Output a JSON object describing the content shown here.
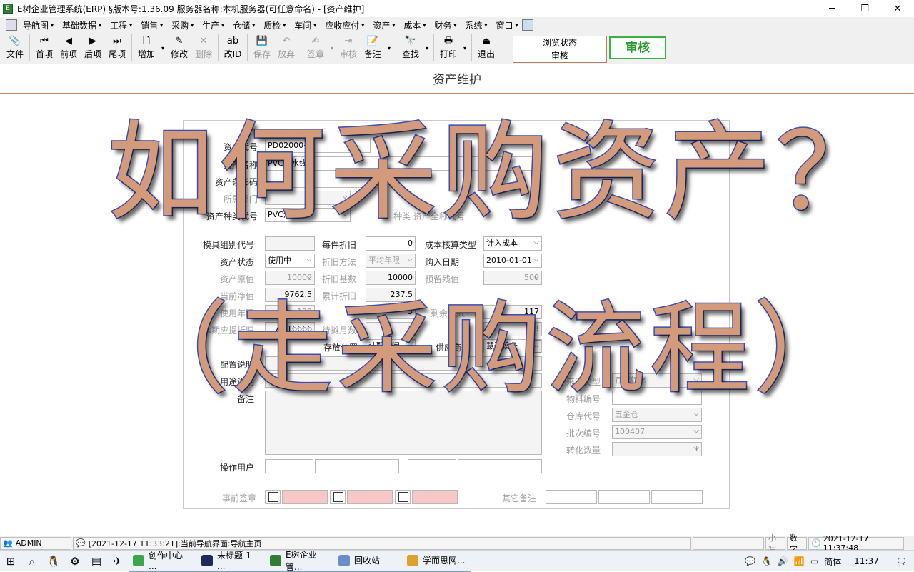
{
  "window": {
    "title": "E树企业管理系统(ERP) §版本号:1.36.09  服务器名称:本机服务器(可任意命名) - [资产维护]",
    "app_icon": "E",
    "minimize": "─",
    "restore": "❐",
    "close": "✕"
  },
  "menu": {
    "items": [
      "导航图",
      "基础数据",
      "工程",
      "销售",
      "采购",
      "生产",
      "仓储",
      "质检",
      "车间",
      "应收应付",
      "资产",
      "成本",
      "财务",
      "系统",
      "窗口"
    ]
  },
  "toolbar": {
    "buttons": [
      {
        "label": "文件",
        "icon": "📎"
      },
      {
        "label": "首项",
        "icon": "⏮"
      },
      {
        "label": "前项",
        "icon": "◀"
      },
      {
        "label": "后项",
        "icon": "▶"
      },
      {
        "label": "尾项",
        "icon": "⏭"
      },
      {
        "label": "增加",
        "icon": "🗋"
      },
      {
        "label": "修改",
        "icon": "✎"
      },
      {
        "label": "删除",
        "icon": "✕"
      },
      {
        "label": "改ID",
        "icon": "ab"
      },
      {
        "label": "保存",
        "icon": "💾"
      },
      {
        "label": "放弃",
        "icon": "↶"
      },
      {
        "label": "签章",
        "icon": "✍"
      },
      {
        "label": "审核",
        "icon": "⇥"
      },
      {
        "label": "备注",
        "icon": "📝"
      },
      {
        "label": "查找",
        "icon": "🔭"
      },
      {
        "label": "打印",
        "icon": "🖶"
      },
      {
        "label": "退出",
        "icon": "⏏"
      }
    ],
    "status_top": "浏览状态",
    "status_bottom": "审核",
    "audit_button": "审核"
  },
  "page_title": "资产维护",
  "overlay": {
    "line1": "如何采购资产？",
    "line2": "（走采购流程）"
  },
  "form": {
    "asset_code_label": "资产代号",
    "asset_code": "PD020004",
    "asset_name_label": "资产名称",
    "asset_name": "PVC流水线",
    "barcode_label": "资产条形码",
    "department_label": "所属部门",
    "category_label": "资产种类代号",
    "category": "PVC流水线",
    "category_right": "种类  资产全称代号",
    "mold_label": "模具组别代号",
    "per_piece_label": "每件折旧",
    "per_piece": "0",
    "cost_type_label": "成本核算类型",
    "cost_type": "计入成本",
    "status_label": "资产状态",
    "status": "使用中",
    "method_label": "折旧方法",
    "method": "平均年限",
    "purchase_date_label": "购入日期",
    "purchase_date": "2010-01-01",
    "original_label": "资产原值",
    "original": "10000",
    "base_label": "折旧基数",
    "base": "10000",
    "residual_label": "预留残值",
    "residual": "500",
    "net_label": "当前净值",
    "net": "9762.5",
    "accum_label": "累计折旧",
    "accum": "237.5",
    "life_label": "使用年限",
    "life": "120",
    "months": "3",
    "remain_label": "剩余月数",
    "remain": "117",
    "period_label": "本期应提折旧",
    "period": "79.16666",
    "amort_label": "待摊月数",
    "amort": "1",
    "amort_right": "3",
    "location_label": "存放位置",
    "location": "装配车间",
    "supplier_label": "供应商",
    "supplier": "慧达设备",
    "spec_label": "配置说明",
    "usage_label": "用途说明",
    "remark_label": "备注",
    "source_type_label": "来源类型",
    "source_type": "存货转化",
    "item_code_label": "物料编号",
    "warehouse_label": "仓库代号",
    "warehouse": "五金仓",
    "batch_label": "批次编号",
    "batch": "100407",
    "qty_label": "转化数量",
    "qty": "1",
    "operator_label": "操作用户",
    "presign_label": "事前签章",
    "other_label": "其它备注",
    "ellipsis": "…"
  },
  "statusbar": {
    "user": "ADMIN",
    "message": "[2021-12-17 11:33:21]:当前导航界面:导航主页",
    "caps": "小写",
    "num": "数字",
    "datetime": "2021-12-17 11:37:48"
  },
  "taskbar": {
    "apps": [
      {
        "label": "创作中心 ...",
        "color": "#3aa64a"
      },
      {
        "label": "未标题-1 ...",
        "color": "#1e2a5a"
      },
      {
        "label": "E树企业管...",
        "color": "#2e7d32"
      },
      {
        "label": "回收站",
        "color": "#6a8fc8"
      },
      {
        "label": "学而思网...",
        "color": "#e0a030"
      }
    ],
    "ime": "简体",
    "time": "11:37"
  }
}
